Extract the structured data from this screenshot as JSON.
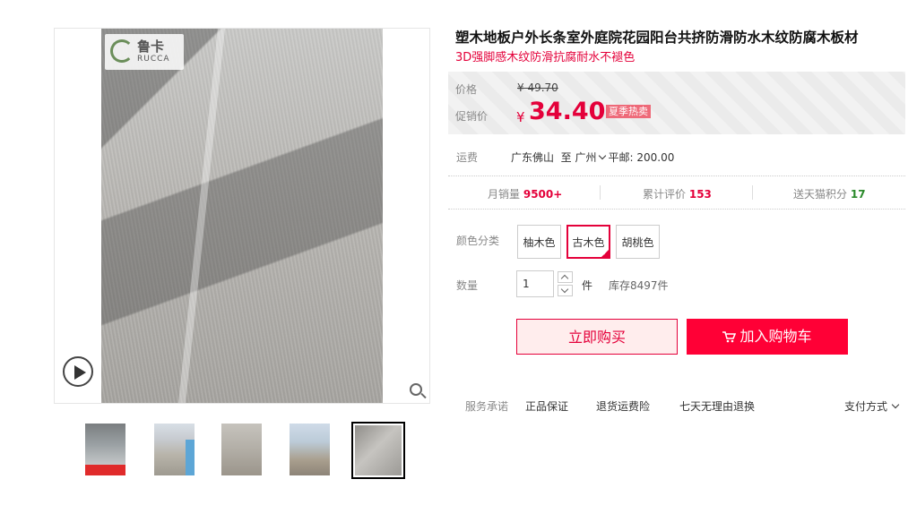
{
  "brand": {
    "logo_cn": "鲁卡",
    "logo_en": "RUCCA"
  },
  "product": {
    "title": "塑木地板户外长条室外庭院花园阳台共挤防滑防水木纹防腐木板材",
    "subtitle": "3D强脚感木纹防滑抗腐耐水不褪色"
  },
  "price": {
    "orig_label": "价格",
    "orig_value": "¥ 49.70",
    "sale_label": "促销价",
    "currency": "¥",
    "sale_value": "34.40",
    "promo_tag": "夏季热卖"
  },
  "shipping": {
    "label": "运费",
    "from": "广东佛山",
    "to_word": "至",
    "to_city": "广州",
    "fee": "平邮: 200.00"
  },
  "stats": {
    "monthly_label": "月销量",
    "monthly_value": "9500+",
    "reviews_label": "累计评价",
    "reviews_value": "153",
    "points_label": "送天猫积分",
    "points_value": "17"
  },
  "options": {
    "label": "颜色分类",
    "items": [
      "柚木色",
      "古木色",
      "胡桃色"
    ],
    "selected": "古木色"
  },
  "quantity": {
    "label": "数量",
    "value": "1",
    "unit": "件",
    "stock": "库存8497件"
  },
  "buttons": {
    "buy_now": "立即购买",
    "add_cart": "加入购物车"
  },
  "services": {
    "label": "服务承诺",
    "items": [
      "正品保证",
      "退货运费险",
      "七天无理由退换"
    ],
    "pay": "支付方式"
  },
  "colors": {
    "accent": "#e4003a",
    "cart": "#ff0036",
    "points": "#2b8a2b"
  }
}
